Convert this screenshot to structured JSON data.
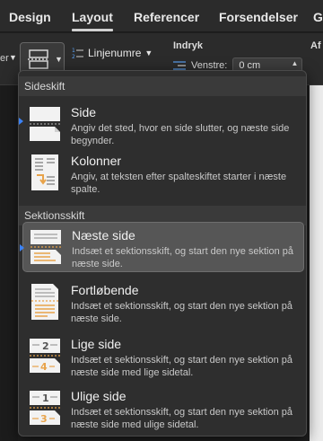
{
  "tabs": [
    {
      "label": "Design"
    },
    {
      "label": "Layout"
    },
    {
      "label": "Referencer"
    },
    {
      "label": "Forsendelser"
    },
    {
      "label": "G"
    }
  ],
  "ribbon": {
    "left_edge_text": "er",
    "linjenumre_label": "Linjenumre",
    "indryk_label": "Indryk",
    "venstre_label": "Venstre:",
    "venstre_value": "0 cm",
    "af_label": "Af"
  },
  "menu": {
    "section_sideskift": "Sideskift",
    "section_sektionsskift": "Sektionsskift",
    "items": [
      {
        "title": "Side",
        "desc": "Angiv det sted, hvor en side slutter, og næste side begynder.",
        "icon": "page-break-icon"
      },
      {
        "title": "Kolonner",
        "desc": "Angiv, at teksten efter spalteskiftet starter i næste spalte.",
        "icon": "column-break-icon"
      },
      {
        "title": "Næste side",
        "desc": "Indsæt et sektionsskift, og start den nye sektion på næste side.",
        "icon": "next-page-section-icon",
        "icon_label": ""
      },
      {
        "title": "Fortløbende",
        "desc": "Indsæt et sektionsskift, og start den nye sektion på næste side.",
        "icon": "continuous-section-icon"
      },
      {
        "title": "Lige side",
        "desc": "Indsæt et sektionsskift, og start den nye sektion på næste side med lige sidetal.",
        "icon": "even-page-section-icon",
        "num_top": "2",
        "num_bottom": "4"
      },
      {
        "title": "Ulige side",
        "desc": "Indsæt et sektionsskift, og start den nye sektion på næste side med ulige sidetal.",
        "icon": "odd-page-section-icon",
        "num_top": "1",
        "num_bottom": "3"
      }
    ]
  },
  "colors": {
    "accent": "#3b82f6",
    "icon_orange": "#e8a34a",
    "selected_bg": "#565656"
  }
}
